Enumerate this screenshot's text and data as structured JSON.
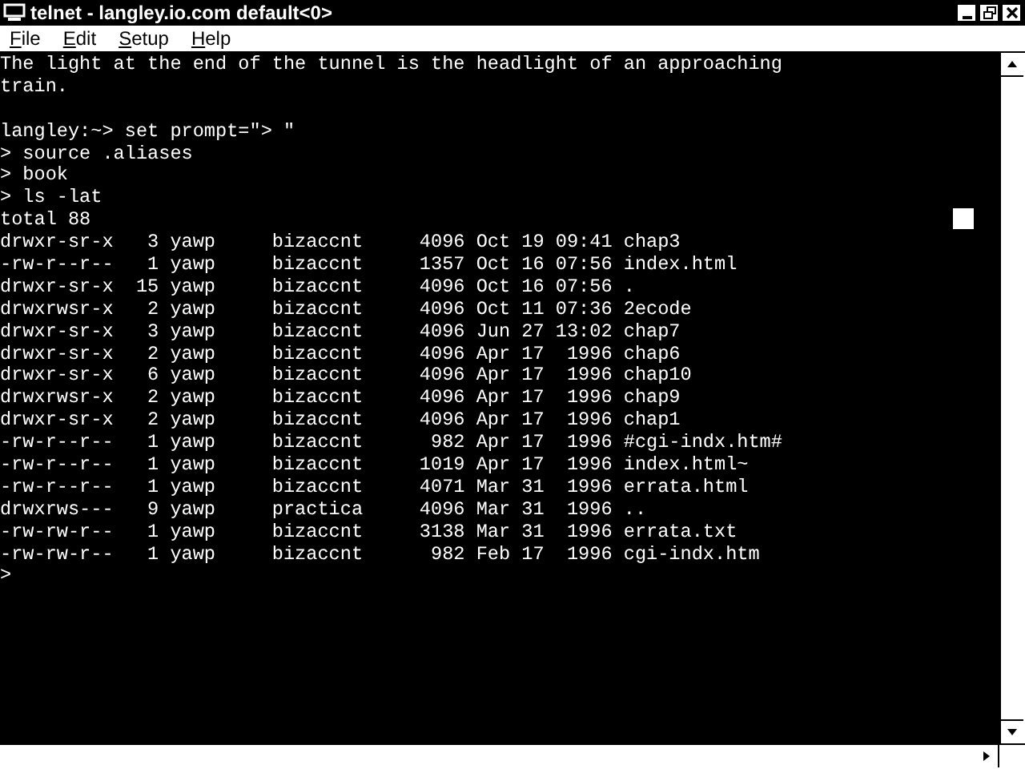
{
  "window": {
    "title": "telnet - langley.io.com default<0>"
  },
  "menu": [
    "File",
    "Edit",
    "Setup",
    "Help"
  ],
  "terminal": {
    "fortune": [
      "The light at the end of the tunnel is the headlight of an approaching",
      "train."
    ],
    "session": [
      "langley:~> set prompt=\"> \"",
      "> source .aliases",
      "> book",
      "> ls -lat",
      "total 88",
      "drwxr-sr-x   3 yawp     bizaccnt     4096 Oct 19 09:41 chap3",
      "-rw-r--r--   1 yawp     bizaccnt     1357 Oct 16 07:56 index.html",
      "drwxr-sr-x  15 yawp     bizaccnt     4096 Oct 16 07:56 .",
      "drwxrwsr-x   2 yawp     bizaccnt     4096 Oct 11 07:36 2ecode",
      "drwxr-sr-x   3 yawp     bizaccnt     4096 Jun 27 13:02 chap7",
      "drwxr-sr-x   2 yawp     bizaccnt     4096 Apr 17  1996 chap6",
      "drwxr-sr-x   6 yawp     bizaccnt     4096 Apr 17  1996 chap10",
      "drwxrwsr-x   2 yawp     bizaccnt     4096 Apr 17  1996 chap9",
      "drwxr-sr-x   2 yawp     bizaccnt     4096 Apr 17  1996 chap1",
      "-rw-r--r--   1 yawp     bizaccnt      982 Apr 17  1996 #cgi-indx.htm#",
      "-rw-r--r--   1 yawp     bizaccnt     1019 Apr 17  1996 index.html~",
      "-rw-r--r--   1 yawp     bizaccnt     4071 Mar 31  1996 errata.html",
      "drwxrws---   9 yawp     practica     4096 Mar 31  1996 ..",
      "-rw-rw-r--   1 yawp     bizaccnt     3138 Mar 31  1996 errata.txt",
      "-rw-rw-r--   1 yawp     bizaccnt      982 Feb 17  1996 cgi-indx.htm",
      ">"
    ]
  }
}
